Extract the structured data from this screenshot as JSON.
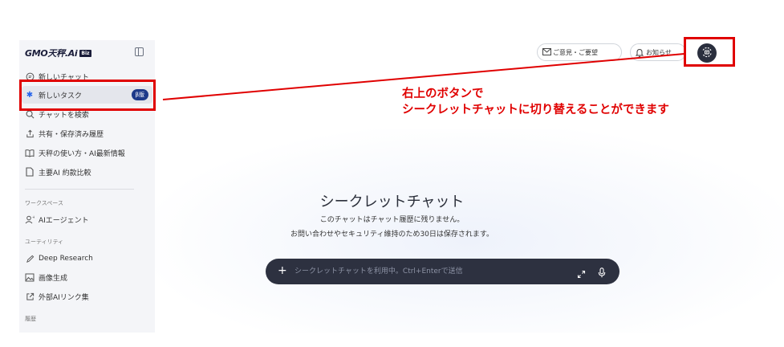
{
  "logo": {
    "text": "GMO天秤.Ai",
    "badge": "Biz"
  },
  "sidebar": {
    "items": [
      {
        "label": "新しいチャット",
        "icon": "chat-bubble-icon"
      },
      {
        "label": "新しいタスク",
        "icon": "asterisk-icon",
        "badge": "β版",
        "active": true
      },
      {
        "label": "チャットを検索",
        "icon": "search-icon"
      },
      {
        "label": "共有・保存済み履歴",
        "icon": "share-icon"
      },
      {
        "label": "天秤の使い方・AI最新情報",
        "icon": "book-icon"
      },
      {
        "label": "主要AI 約款比較",
        "icon": "document-icon"
      }
    ],
    "workspace_section": "ワークスペース",
    "workspace_items": [
      {
        "label": "AIエージェント",
        "icon": "agent-icon"
      }
    ],
    "utility_section": "ユーティリティ",
    "utility_items": [
      {
        "label": "Deep Research",
        "icon": "pen-icon"
      },
      {
        "label": "画像生成",
        "icon": "image-icon"
      },
      {
        "label": "外部AIリンク集",
        "icon": "external-link-icon"
      }
    ],
    "history_section": "履歴"
  },
  "header": {
    "feedback_label": "ご意見・ご要望",
    "notifications_label": "お知らせ"
  },
  "annotation": {
    "line1": "右上のボタンで",
    "line2": "シークレットチャットに切り替えることができます",
    "color": "#e00000"
  },
  "main": {
    "title": "シークレットチャット",
    "subtitle1": "このチャットはチャット履歴に残りません。",
    "subtitle2": "お問い合わせやセキュリティ維持のため30日は保存されます。",
    "input_placeholder": "シークレットチャットを利用中。Ctrl+Enterで送信"
  }
}
